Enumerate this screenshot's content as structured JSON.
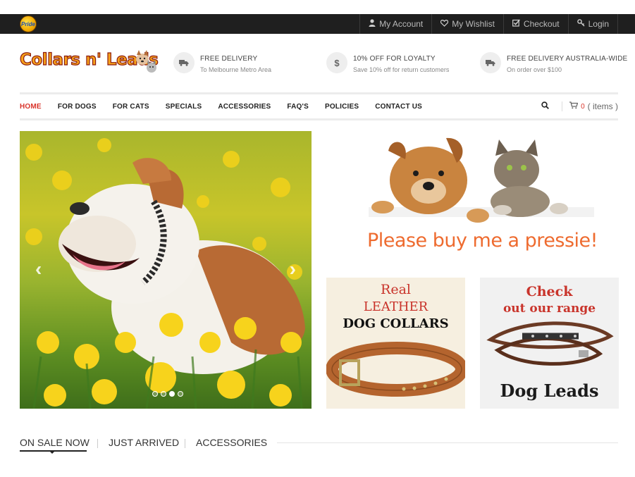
{
  "topbar": {
    "badge_text": "Pride",
    "links": [
      {
        "label": "My Account",
        "icon": "user-icon"
      },
      {
        "label": "My Wishlist",
        "icon": "heart-icon"
      },
      {
        "label": "Checkout",
        "icon": "checkbox-icon"
      },
      {
        "label": "Login",
        "icon": "key-icon"
      }
    ]
  },
  "header": {
    "logo_text": "Collars n' Leads",
    "features": [
      {
        "icon": "truck-icon",
        "title": "FREE DELIVERY",
        "subtitle": "To Melbourne Metro Area"
      },
      {
        "icon": "dollar-icon",
        "title": "10% OFF FOR LOYALTY",
        "subtitle": "Save 10% off for return customers"
      },
      {
        "icon": "truck-icon",
        "title": "FREE DELIVERY AUSTRALIA-WIDE",
        "subtitle": "On order over $100"
      }
    ]
  },
  "nav": {
    "items": [
      "HOME",
      "FOR DOGS",
      "FOR CATS",
      "SPECIALS",
      "ACCESSORIES",
      "FAQ'S",
      "POLICIES",
      "CONTACT US"
    ],
    "active": "HOME",
    "cart_count": "0",
    "cart_label": "( items )"
  },
  "slider": {
    "prev": "‹",
    "next": "›",
    "dot_count": 4,
    "active_dot": 2
  },
  "banner": {
    "caption": "Please buy me a pressie!"
  },
  "tiles": {
    "collars": {
      "line1": "Real",
      "line2": "LEATHER",
      "line3": "DOG COLLARS"
    },
    "leads": {
      "line1": "Check",
      "line2": "out our range",
      "line3": "Dog Leads"
    }
  },
  "tabs": [
    "ON SALE NOW",
    "JUST ARRIVED",
    "ACCESSORIES"
  ],
  "colors": {
    "accent": "#d9342b",
    "topbar": "#1f1f1f",
    "caption": "#ee6b2f",
    "tile_red": "#c9342b"
  }
}
